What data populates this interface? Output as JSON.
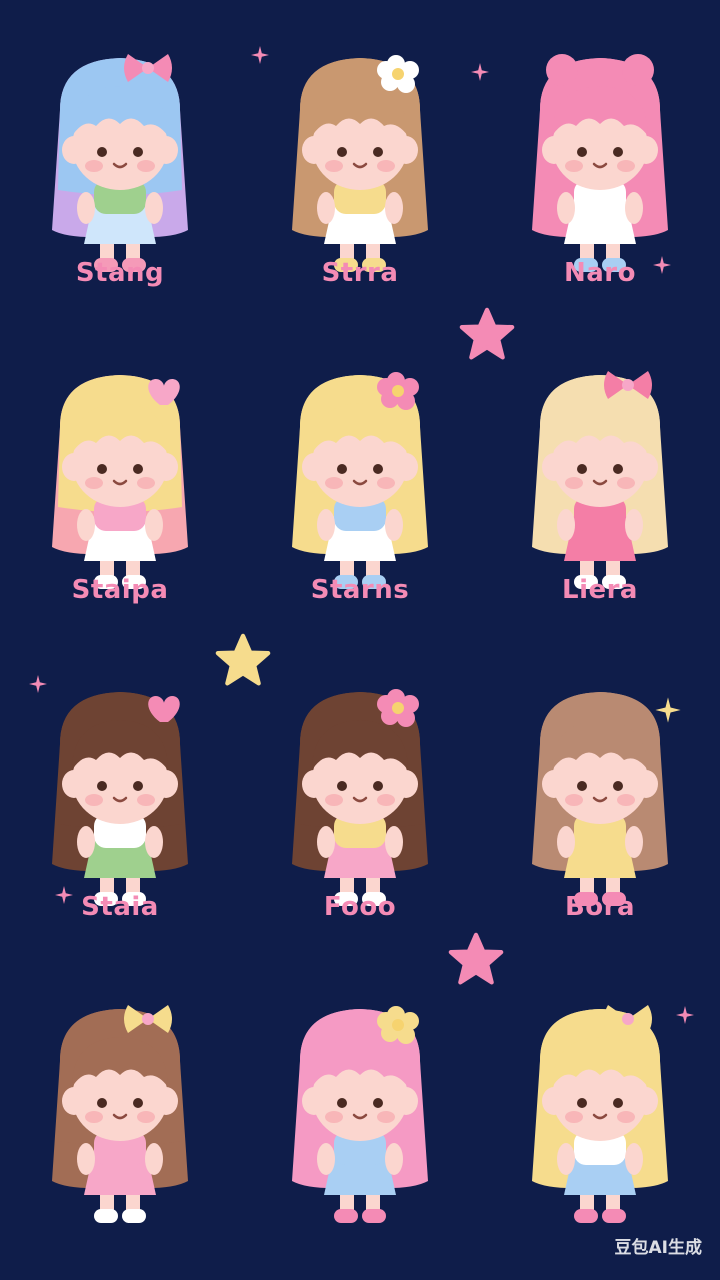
{
  "characters": [
    {
      "name": "Stang",
      "hair": "#9cc7f2",
      "hair2": "#c9a9ea",
      "dress": "#cfe6fb",
      "top": "#9fd08e",
      "shoe": "#f59ab8",
      "accent": "#f48bb5",
      "accessory": "bow"
    },
    {
      "name": "Strra",
      "hair": "#c99870",
      "hair2": "#c99870",
      "dress": "#ffffff",
      "top": "#f6dc8d",
      "shoe": "#f6dc8d",
      "accent": "#ffffff",
      "accessory": "flower"
    },
    {
      "name": "Naro",
      "hair": "#f48bb5",
      "hair2": "#f48bb5",
      "dress": "#ffffff",
      "top": "#ffffff",
      "shoe": "#a9cff3",
      "accent": "#f6d36f",
      "accessory": "bun"
    },
    {
      "name": "Staipa",
      "hair": "#f6dc8d",
      "hair2": "#f7a7b0",
      "dress": "#ffffff",
      "top": "#f7a7c8",
      "shoe": "#ffffff",
      "accent": "#f7a7c8",
      "accessory": "heart"
    },
    {
      "name": "Starns",
      "hair": "#f6dc8d",
      "hair2": "#f6dc8d",
      "dress": "#ffffff",
      "top": "#a9cff3",
      "shoe": "#a9cff3",
      "accent": "#f48bb5",
      "accessory": "flower"
    },
    {
      "name": "Liera",
      "hair": "#f5deb0",
      "hair2": "#f5deb0",
      "dress": "#f47ea6",
      "top": "#f47ea6",
      "shoe": "#ffffff",
      "accent": "#f47ea6",
      "accessory": "bow"
    },
    {
      "name": "Staia",
      "hair": "#6e4333",
      "hair2": "#6e4333",
      "dress": "#9fd08e",
      "top": "#ffffff",
      "shoe": "#ffffff",
      "accent": "#f48bb5",
      "accessory": "heart"
    },
    {
      "name": "Fooo",
      "hair": "#6e4333",
      "hair2": "#6e4333",
      "dress": "#f7a7c8",
      "top": "#f6dc8d",
      "shoe": "#ffffff",
      "accent": "#f48bb5",
      "accessory": "flower"
    },
    {
      "name": "Bora",
      "hair": "#b98a72",
      "hair2": "#b98a72",
      "dress": "#f6dc8d",
      "top": "#f6dc8d",
      "shoe": "#f48bb5",
      "accent": "#f48bb5",
      "accessory": "none"
    },
    {
      "name": "",
      "hair": "#a26d55",
      "hair2": "#a26d55",
      "dress": "#f7a7c8",
      "top": "#f7a7c8",
      "shoe": "#ffffff",
      "accent": "#f6dc8d",
      "accessory": "bow"
    },
    {
      "name": "",
      "hair": "#f59ac4",
      "hair2": "#f59ac4",
      "dress": "#a9cff3",
      "top": "#a9cff3",
      "shoe": "#f48bb5",
      "accent": "#f6dc8d",
      "accessory": "flower"
    },
    {
      "name": "",
      "hair": "#f6dc8d",
      "hair2": "#f6dc8d",
      "dress": "#a9cff3",
      "top": "#ffffff",
      "shoe": "#f48bb5",
      "accent": "#f6dc8d",
      "accessory": "bow"
    }
  ],
  "watermark": "豆包AI生成",
  "colors": {
    "background": "#0f1d4a",
    "name_text": "#f48bb5",
    "skin": "#fbd6cf",
    "cheek": "#f7a0a8"
  }
}
